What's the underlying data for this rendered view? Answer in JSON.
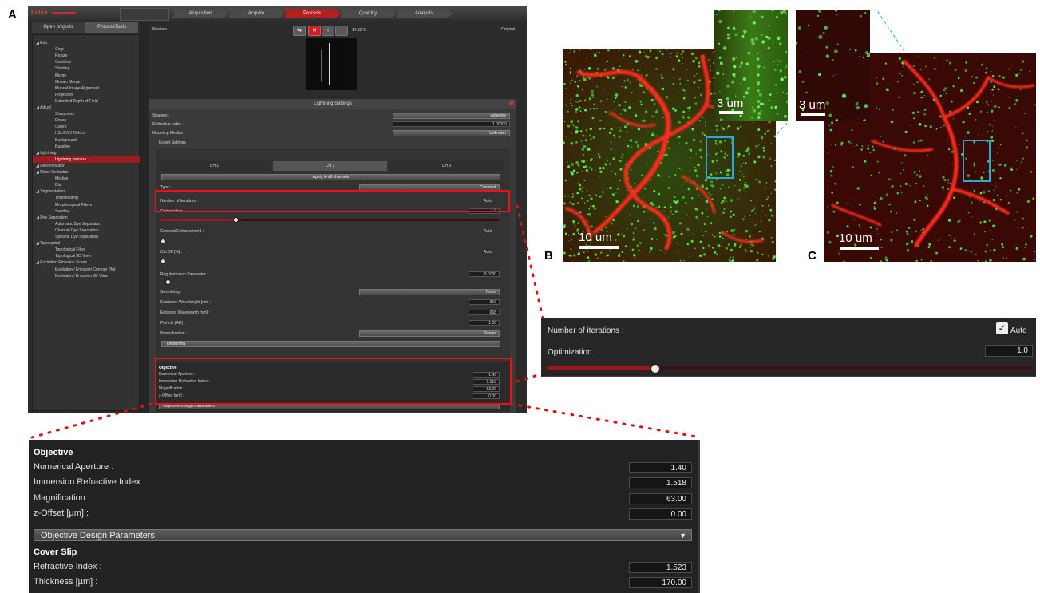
{
  "panel_labels": {
    "a": "A",
    "b": "B",
    "c": "C"
  },
  "topbar": {
    "steps": [
      "Acquisition",
      "Acquire",
      "Process",
      "Quantify",
      "Analysis"
    ],
    "active_step": "Process"
  },
  "left_panel": {
    "tabs": [
      "Open projects",
      "ProcessTools"
    ],
    "tree": [
      {
        "label": "Edit",
        "type": "cat"
      },
      {
        "label": "Crop",
        "type": "sub"
      },
      {
        "label": "Resize",
        "type": "sub"
      },
      {
        "label": "Combine",
        "type": "sub"
      },
      {
        "label": "Shading",
        "type": "sub"
      },
      {
        "label": "Merge",
        "type": "sub"
      },
      {
        "label": "Mosaic Merge",
        "type": "sub"
      },
      {
        "label": "Manual Image Alignment",
        "type": "sub"
      },
      {
        "label": "Projection",
        "type": "sub"
      },
      {
        "label": "Extended Depth of Field",
        "type": "sub"
      },
      {
        "label": "Adjust",
        "type": "cat"
      },
      {
        "label": "Sharpness",
        "type": "sub"
      },
      {
        "label": "Phase",
        "type": "sub"
      },
      {
        "label": "Colors",
        "type": "sub"
      },
      {
        "label": "HSL/HSV Colors",
        "type": "sub"
      },
      {
        "label": "Background",
        "type": "sub"
      },
      {
        "label": "Baseline",
        "type": "sub"
      },
      {
        "label": "Lightning",
        "type": "cat"
      },
      {
        "label": "Lightning process",
        "type": "sub",
        "selected": true
      },
      {
        "label": "Deconvolution",
        "type": "cat"
      },
      {
        "label": "Noise Reduction",
        "type": "cat"
      },
      {
        "label": "Median",
        "type": "sub"
      },
      {
        "label": "Blur",
        "type": "sub"
      },
      {
        "label": "Segmentation",
        "type": "cat"
      },
      {
        "label": "Thresholding",
        "type": "sub"
      },
      {
        "label": "Morphological Filters",
        "type": "sub"
      },
      {
        "label": "Seeding",
        "type": "sub"
      },
      {
        "label": "Dye Separation",
        "type": "cat"
      },
      {
        "label": "Automatic Dye Separation",
        "type": "sub"
      },
      {
        "label": "Channel Dye Separation",
        "type": "sub"
      },
      {
        "label": "Spectral Dye Separation",
        "type": "sub"
      },
      {
        "label": "Topological",
        "type": "cat"
      },
      {
        "label": "Topological Filter",
        "type": "sub"
      },
      {
        "label": "Topological 3D View",
        "type": "sub"
      },
      {
        "label": "Excitation Emission Scans",
        "type": "cat"
      },
      {
        "label": "Excitation / Emission Contour Plot",
        "type": "sub"
      },
      {
        "label": "Excitation / Emission 3D View",
        "type": "sub"
      }
    ]
  },
  "preview": {
    "label": "Preview",
    "original_label": "Original",
    "zoom": "14.32 %"
  },
  "settings": {
    "title": "Lightning Settings",
    "strategy_label": "Strategy :",
    "strategy_value": "Adaptive",
    "ri_label": "Refractive Index :",
    "ri_value": "1.00000",
    "mounting_label": "Mounting Medium :",
    "mounting_value": "Unknown",
    "expert_label": "Expert Settings",
    "channels": [
      "CH 1",
      "CH 2",
      "CH 3"
    ],
    "apply_all": "Apply to all channels",
    "type_label": "Type :",
    "type_value": "Confocal",
    "iterations_label": "Number of iterations :",
    "auto": "Auto",
    "optimization_label": "Optimization :",
    "optimization_value": "1.0",
    "optimization_level": 0.22,
    "contrast_label": "Contrast Enhancement :",
    "cutoff_label": "Cut Off [%] :",
    "reg_label": "Regularization Parameter :",
    "reg_value": "0.0100",
    "smoothing_label": "Smoothing :",
    "smoothing_value": "None",
    "exc_label": "Excitation Wavelength [nm] :",
    "exc_value": "653",
    "em_label": "Emission Wavelength [nm] :",
    "em_value": "668",
    "pinhole_label": "Pinhole [AU] :",
    "pinhole_value": "1.00",
    "norm_label": "Normalization :",
    "norm_value": "Range",
    "deblurring": "Deblurring",
    "objective_head": "Objective",
    "na_label": "Numerical Aperture :",
    "na_value": "1.40",
    "imm_label": "Immersion Refractive Index :",
    "imm_value": "1.518",
    "mag_label": "Magnification :",
    "mag_value": "63.00",
    "z_label": "z-Offset [µm] :",
    "z_value": "0.00",
    "objdesign": "Objective Design Parameters"
  },
  "images": {
    "b_scale_main": "10 um",
    "b_scale_inset": "3 um",
    "c_scale_main": "10 um",
    "c_scale_inset": "3 um"
  },
  "zoom_right": {
    "iterations_label": "Number of iterations :",
    "auto": "Auto",
    "optimization_label": "Optimization :",
    "optimization_value": "1.0",
    "optimization_level": 0.22
  },
  "zoom_bottom": {
    "objective_head": "Objective",
    "na_label": "Numerical Aperture :",
    "na_value": "1.40",
    "imm_label": "Immersion Refractive Index :",
    "imm_value": "1.518",
    "mag_label": "Magnification :",
    "mag_value": "63.00",
    "z_label": "z-Offset [µm] :",
    "z_value": "0.00",
    "objdesign": "Objective Design Parameters",
    "coverslip_head": "Cover Slip",
    "cs_ri_label": "Refractive Index :",
    "cs_ri_value": "1.523",
    "thick_label": "Thickness [µm] :",
    "thick_value": "170.00"
  },
  "colors": {
    "accent": "#b41f1f",
    "highlight_box": "#e11111",
    "roi": "#2aa8d8"
  }
}
